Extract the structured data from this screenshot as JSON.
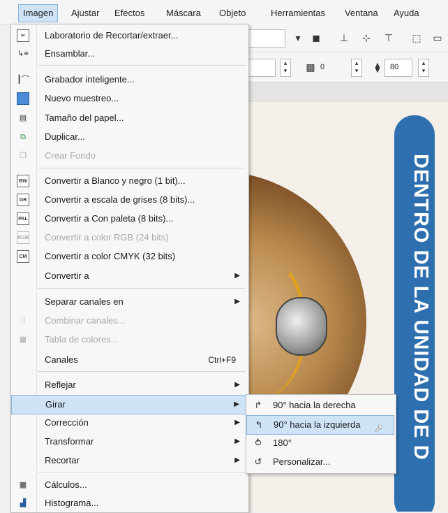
{
  "menubar": {
    "items": [
      {
        "label": "Imagen",
        "active": true
      },
      {
        "label": "Ajustar"
      },
      {
        "label": "Efectos"
      },
      {
        "label": "Máscara"
      },
      {
        "label": "Objeto"
      },
      {
        "label": "Herramientas"
      },
      {
        "label": "Ventana"
      },
      {
        "label": "Ayuda"
      }
    ]
  },
  "toolbar": {
    "value_a": "0",
    "value_b": "80"
  },
  "canvas": {
    "banner_text": "DENTRO DE LA UNIDAD DE D"
  },
  "menu": {
    "items": [
      {
        "label": "Laboratorio de Recortar/extraer...",
        "icon": "cut-lab-icon"
      },
      {
        "label": "Ensamblar...",
        "icon": "stitch-icon"
      },
      {
        "label": "Grabador inteligente...",
        "icon": "smart-carver-icon"
      },
      {
        "label": "Nuevo muestreo...",
        "icon": "resample-icon"
      },
      {
        "label": "Tamaño del papel...",
        "icon": "paper-size-icon"
      },
      {
        "label": "Duplicar...",
        "icon": "duplicate-icon"
      },
      {
        "label": "Crear Fondo",
        "icon": "create-background-icon",
        "disabled": true
      },
      {
        "label": "Convertir a Blanco y negro (1 bit)...",
        "icon": "bw-icon",
        "badge": "BW"
      },
      {
        "label": "Convertir a escala de grises (8 bits)...",
        "icon": "grayscale-icon",
        "badge": "GR"
      },
      {
        "label": "Convertir a Con paleta (8 bits)...",
        "icon": "paletted-icon",
        "badge": "PAL"
      },
      {
        "label": "Convertir a color RGB (24 bits)",
        "icon": "rgb-icon",
        "badge": "RGB",
        "disabled": true
      },
      {
        "label": "Convertir a color CMYK (32 bits)",
        "icon": "cmyk-icon",
        "badge": "CM"
      },
      {
        "label": "Convertir a",
        "submenu": true
      },
      {
        "label": "Separar canales en",
        "submenu": true
      },
      {
        "label": "Combinar canales...",
        "icon": "combine-channels-icon",
        "disabled": true
      },
      {
        "label": "Tabla de colores...",
        "icon": "color-table-icon",
        "disabled": true
      },
      {
        "label": "Canales",
        "shortcut": "Ctrl+F9"
      },
      {
        "label": "Reflejar",
        "submenu": true
      },
      {
        "label": "Girar",
        "submenu": true,
        "highlighted": true
      },
      {
        "label": "Corrección",
        "submenu": true
      },
      {
        "label": "Transformar",
        "submenu": true
      },
      {
        "label": "Recortar",
        "submenu": true
      },
      {
        "label": "Cálculos...",
        "icon": "calculations-icon"
      },
      {
        "label": "Histograma...",
        "icon": "histogram-icon"
      }
    ]
  },
  "submenu": {
    "items": [
      {
        "label": "90° hacia la derecha",
        "icon": "rotate-right-icon"
      },
      {
        "label": "90° hacia la izquierda",
        "icon": "rotate-left-icon",
        "highlighted": true
      },
      {
        "label": "180°",
        "icon": "rotate-180-icon"
      },
      {
        "label": "Personalizar...",
        "icon": "rotate-custom-icon"
      }
    ]
  },
  "colors": {
    "highlight": "#cfe3f7",
    "highlight_border": "#8db4dc",
    "banner": "#2e6fb0"
  }
}
